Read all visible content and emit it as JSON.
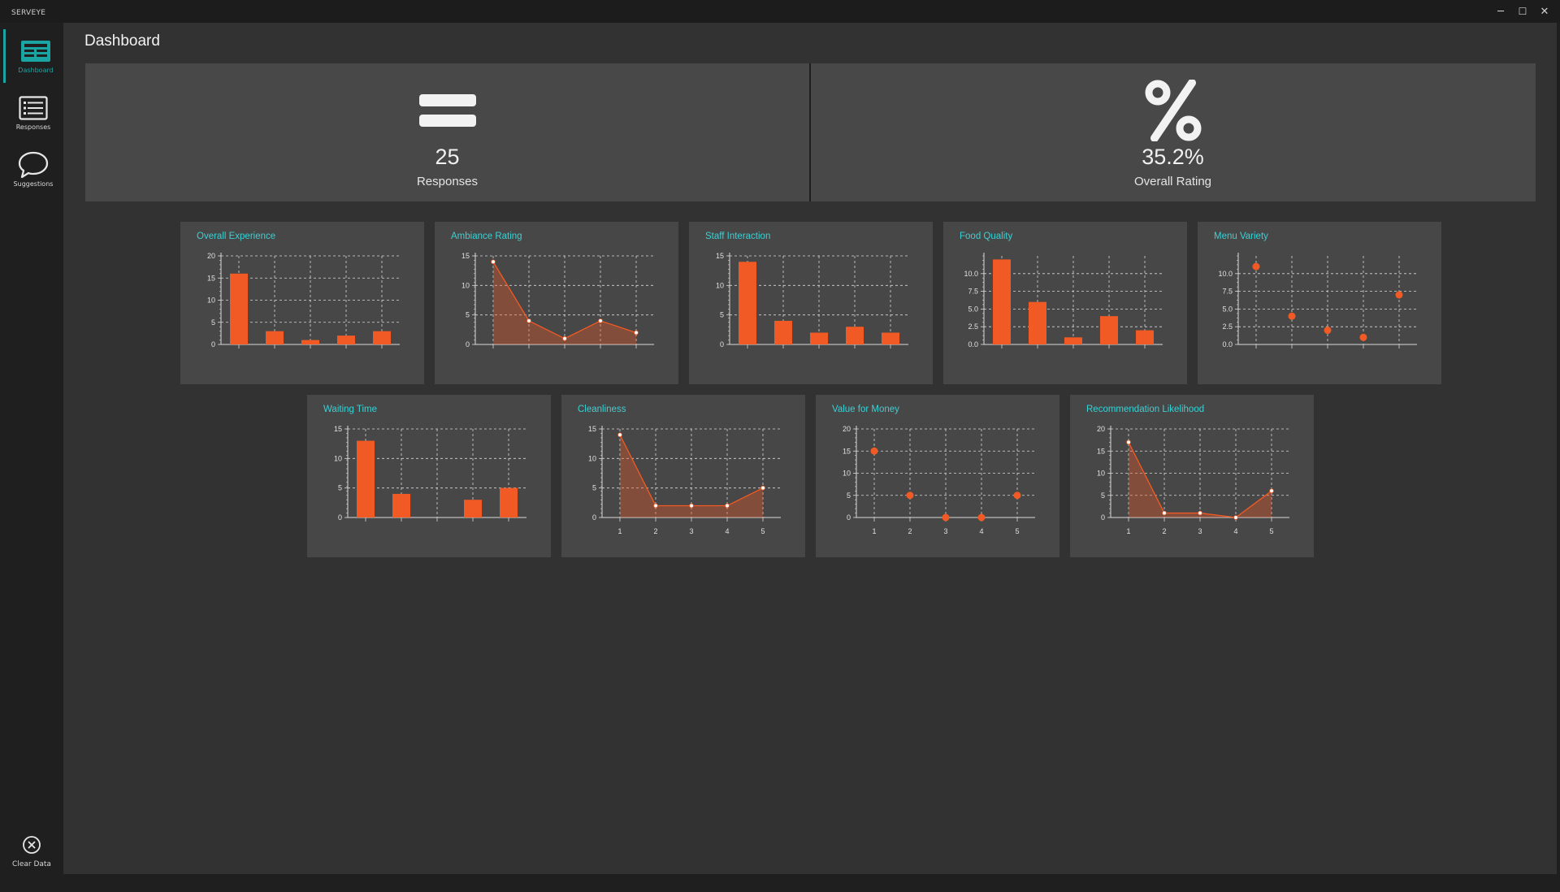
{
  "app": {
    "title": "SERVEYE"
  },
  "window": {
    "minimize": "─",
    "maximize": "☐",
    "close": "✕"
  },
  "sidebar": {
    "items": [
      {
        "label": "Dashboard",
        "icon": "dashboard-icon",
        "active": true
      },
      {
        "label": "Responses",
        "icon": "list-icon",
        "active": false
      },
      {
        "label": "Suggestions",
        "icon": "chat-bubble-icon",
        "active": false
      }
    ],
    "clear": {
      "label": "Clear Data",
      "icon": "close-circle-icon"
    }
  },
  "page": {
    "title": "Dashboard"
  },
  "stats": {
    "responses": {
      "value": "25",
      "label": "Responses",
      "icon": "equals-icon"
    },
    "rating": {
      "value": "35.2%",
      "label": "Overall Rating",
      "icon": "percent-icon"
    }
  },
  "colors": {
    "accent": "#f15a24",
    "title": "#3bd0d4",
    "card": "#474747",
    "grid": "#d8d8d8"
  },
  "chart_data": [
    {
      "title": "Overall Experience",
      "type": "bar",
      "x": [
        1,
        2,
        3,
        4,
        5
      ],
      "values": [
        16,
        3,
        1,
        2,
        3
      ],
      "ylim": [
        0,
        20
      ],
      "yticks": [
        "0",
        "5",
        "10",
        "15",
        "20"
      ],
      "xticklabels_visible": false
    },
    {
      "title": "Ambiance Rating",
      "type": "area",
      "x": [
        1,
        2,
        3,
        4,
        5
      ],
      "values": [
        14,
        4,
        1,
        4,
        2
      ],
      "ylim": [
        0,
        15
      ],
      "yticks": [
        "0",
        "5",
        "10",
        "15"
      ],
      "xticklabels_visible": false
    },
    {
      "title": "Staff Interaction",
      "type": "bar",
      "x": [
        1,
        2,
        3,
        4,
        5
      ],
      "values": [
        14,
        4,
        2,
        3,
        2
      ],
      "ylim": [
        0,
        15
      ],
      "yticks": [
        "0",
        "5",
        "10",
        "15"
      ],
      "xticklabels_visible": false
    },
    {
      "title": "Food Quality",
      "type": "bar",
      "x": [
        1,
        2,
        3,
        4,
        5
      ],
      "values": [
        12,
        6,
        1,
        4,
        2
      ],
      "ylim": [
        0,
        12.5
      ],
      "yticks": [
        "0.0",
        "2.5",
        "5.0",
        "7.5",
        "10.0"
      ],
      "xticklabels_visible": false
    },
    {
      "title": "Menu Variety",
      "type": "scatter",
      "x": [
        1,
        2,
        3,
        4,
        5
      ],
      "values": [
        11,
        4,
        2,
        1,
        7
      ],
      "ylim": [
        0,
        12.5
      ],
      "yticks": [
        "0.0",
        "2.5",
        "5.0",
        "7.5",
        "10.0"
      ],
      "xticklabels_visible": false
    },
    {
      "title": "Waiting Time",
      "type": "bar",
      "x": [
        1,
        2,
        3,
        4,
        5
      ],
      "values": [
        13,
        4,
        0,
        3,
        5
      ],
      "ylim": [
        0,
        15
      ],
      "yticks": [
        "0",
        "5",
        "10",
        "15"
      ],
      "xticklabels_visible": false
    },
    {
      "title": "Cleanliness",
      "type": "area",
      "x": [
        1,
        2,
        3,
        4,
        5
      ],
      "values": [
        14,
        2,
        2,
        2,
        5
      ],
      "ylim": [
        0,
        15
      ],
      "yticks": [
        "0",
        "5",
        "10",
        "15"
      ],
      "xticklabels_visible": true,
      "xticks": [
        "1",
        "2",
        "3",
        "4",
        "5"
      ]
    },
    {
      "title": "Value for Money",
      "type": "scatter",
      "x": [
        1,
        2,
        3,
        4,
        5
      ],
      "values": [
        15,
        5,
        0,
        0,
        5
      ],
      "ylim": [
        0,
        20
      ],
      "yticks": [
        "0",
        "5",
        "10",
        "15",
        "20"
      ],
      "xticklabels_visible": true,
      "xticks": [
        "1",
        "2",
        "3",
        "4",
        "5"
      ]
    },
    {
      "title": "Recommendation Likelihood",
      "type": "area",
      "x": [
        1,
        2,
        3,
        4,
        5
      ],
      "values": [
        17,
        1,
        1,
        0,
        6
      ],
      "ylim": [
        0,
        20
      ],
      "yticks": [
        "0",
        "5",
        "10",
        "15",
        "20"
      ],
      "xticklabels_visible": true,
      "xticks": [
        "1",
        "2",
        "3",
        "4",
        "5"
      ]
    }
  ]
}
